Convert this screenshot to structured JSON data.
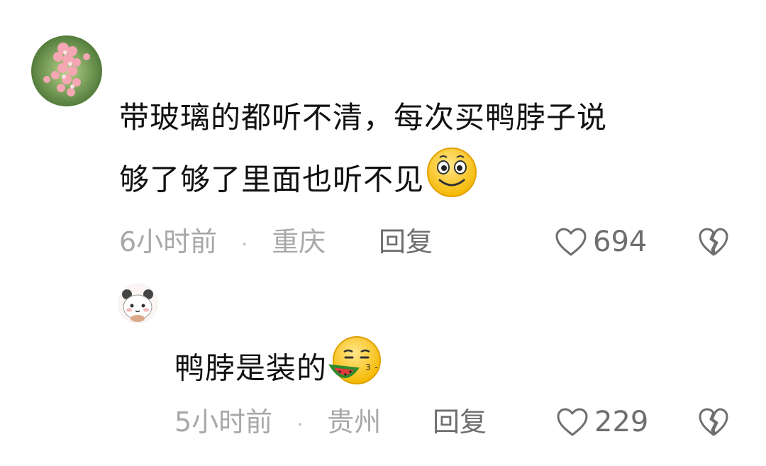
{
  "comments": [
    {
      "avatar_icon": "flower-avatar-icon",
      "text_line1": "带玻璃的都听不清，每次买鸭脖子说",
      "text_line2": "够了够了里面也听不见",
      "emoji": "smile-emoji-icon",
      "time": "6小时前",
      "separator": "·",
      "location": "重庆",
      "reply_label": "回复",
      "likes": "694"
    },
    {
      "avatar_icon": "panda-bear-avatar-icon",
      "text": "鸭脖是装的",
      "emoji": "watermelon-eating-emoji-icon",
      "time": "5小时前",
      "separator": "·",
      "location": "贵州",
      "reply_label": "回复",
      "likes": "229"
    }
  ],
  "colors": {
    "text": "#111111",
    "meta": "#a8a8a8",
    "action": "#6e6e6e",
    "background": "#ffffff"
  }
}
